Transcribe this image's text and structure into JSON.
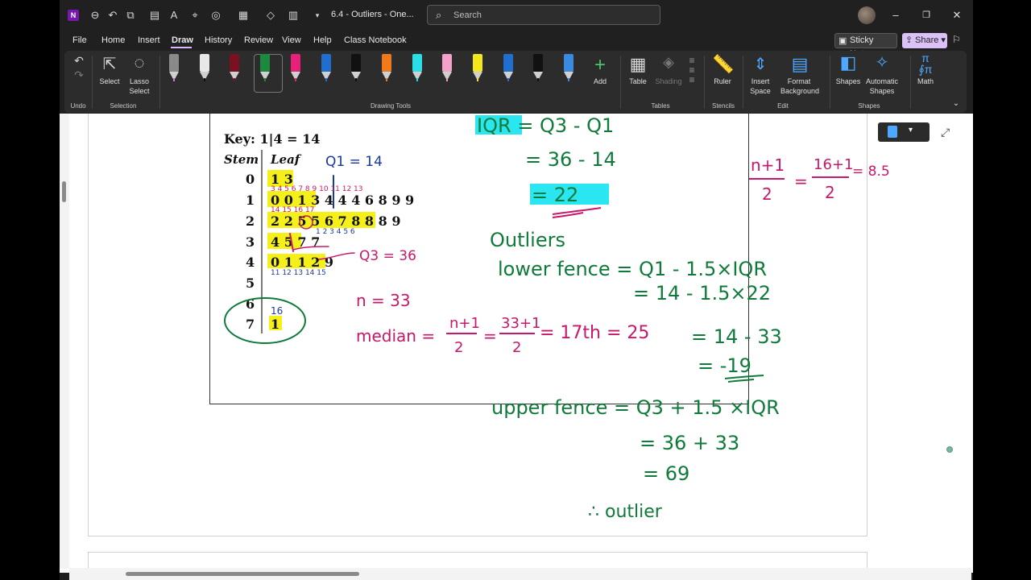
{
  "titlebar": {
    "doc_title": "6.4 - Outliers  -  One...",
    "search_placeholder": "Search"
  },
  "menu": {
    "tabs": [
      "File",
      "Home",
      "Insert",
      "Draw",
      "History",
      "Review",
      "View",
      "Help",
      "Class Notebook"
    ],
    "active_tab": "Draw",
    "sticky_notes": "Sticky Notes",
    "share": "Share"
  },
  "ribbon": {
    "undo_group": "Undo",
    "select": "Select",
    "lasso_select_1": "Lasso",
    "lasso_select_2": "Select",
    "selection_group": "Selection",
    "add": "Add",
    "drawing_tools_group": "Drawing Tools",
    "table": "Table",
    "shading": "Shading",
    "tables_group": "Tables",
    "ruler": "Ruler",
    "stencils_group": "Stencils",
    "insert_space_1": "Insert",
    "insert_space_2": "Space",
    "format_background_1": "Format",
    "format_background_2": "Background",
    "edit_group": "Edit",
    "shapes": "Shapes",
    "automatic_shapes_1": "Automatic",
    "automatic_shapes_2": "Shapes",
    "shapes_group": "Shapes",
    "math": "Math",
    "pens": [
      {
        "name": "pencil-gray",
        "color": "#8a8a8a",
        "tip": "#d07ad8"
      },
      {
        "name": "pen-white",
        "color": "#e8e8e8",
        "tip": "#111"
      },
      {
        "name": "pen-darkred",
        "color": "#7a1020",
        "tip": "#7a1020"
      },
      {
        "name": "pen-green",
        "color": "#1a8a3c",
        "tip": "#1a8a3c"
      },
      {
        "name": "pen-pink",
        "color": "#e8207a",
        "tip": "#e8207a"
      },
      {
        "name": "pen-blue",
        "color": "#1e6fd0",
        "tip": "#1e6fd0"
      },
      {
        "name": "pen-black",
        "color": "#111111",
        "tip": "#111"
      },
      {
        "name": "pen-orange",
        "color": "#f07a1a",
        "tip": "#f07a1a"
      },
      {
        "name": "highlighter-cyan",
        "color": "#2ae0e8",
        "tip": "#2ae0e8"
      },
      {
        "name": "highlighter-pink",
        "color": "#f5a0c8",
        "tip": "#f5a0c8"
      },
      {
        "name": "highlighter-yellow",
        "color": "#f5e81a",
        "tip": "#f5e81a"
      },
      {
        "name": "pen-blue-2",
        "color": "#1e6fd0",
        "tip": "#1e6fd0"
      },
      {
        "name": "pen-black-2",
        "color": "#111111",
        "tip": "#111"
      },
      {
        "name": "pen-blue-3",
        "color": "#3a8ae0",
        "tip": "#3a8ae0"
      }
    ]
  },
  "stemplot": {
    "key": "Key: 1|4 = 14",
    "stem_header": "Stem",
    "leaf_header": "Leaf",
    "rows": [
      {
        "stem": "0",
        "leaf": "1 3"
      },
      {
        "stem": "1",
        "leaf": "0 0 1 3 4 4 4 6 8 9 9"
      },
      {
        "stem": "2",
        "leaf": "2 2 5 5 6 7 8 8 8 9"
      },
      {
        "stem": "3",
        "leaf": "4 5 7 7"
      },
      {
        "stem": "4",
        "leaf": "0 1 1 2 9"
      },
      {
        "stem": "5",
        "leaf": ""
      },
      {
        "stem": "6",
        "leaf": ""
      },
      {
        "stem": "7",
        "leaf": "1"
      }
    ]
  },
  "ink": {
    "q1": "Q1 = 14",
    "q3": "Q3 = 36",
    "n": "n = 33",
    "median": "median =",
    "median_frac1_num": "n+1",
    "median_frac1_den": "2",
    "median_frac2_num": "33+1",
    "median_frac2_den": "2",
    "median_rest": "= 17th = 25",
    "iqr_line1": "IQR = Q3 - Q1",
    "iqr_line2": "= 36 - 14",
    "iqr_line3": "= 22",
    "pos_num1": "n+1",
    "pos_den1": "2",
    "pos_num2": "16+1",
    "pos_den2": "2",
    "pos_result": "= 8.5",
    "outliers": "Outliers",
    "lower_fence": "lower fence =  Q1 - 1.5×IQR",
    "lower_2": "= 14 - 1.5×22",
    "lower_3": "= 14 - 33",
    "lower_4": "= -19",
    "upper_fence": "upper fence =  Q3 + 1.5 ×IQR",
    "upper_2": "= 36 + 33",
    "upper_3": "= 69",
    "therefore": "∴ outlier",
    "circled_16": "16"
  },
  "colors": {
    "ink_green": "#0f7a3a",
    "ink_pink": "#c8186a",
    "ink_blue": "#1a3a9a",
    "highlight_yellow": "#f5f01a",
    "highlight_cyan": "#2ae6f0",
    "brand_purple": "#7719aa"
  }
}
